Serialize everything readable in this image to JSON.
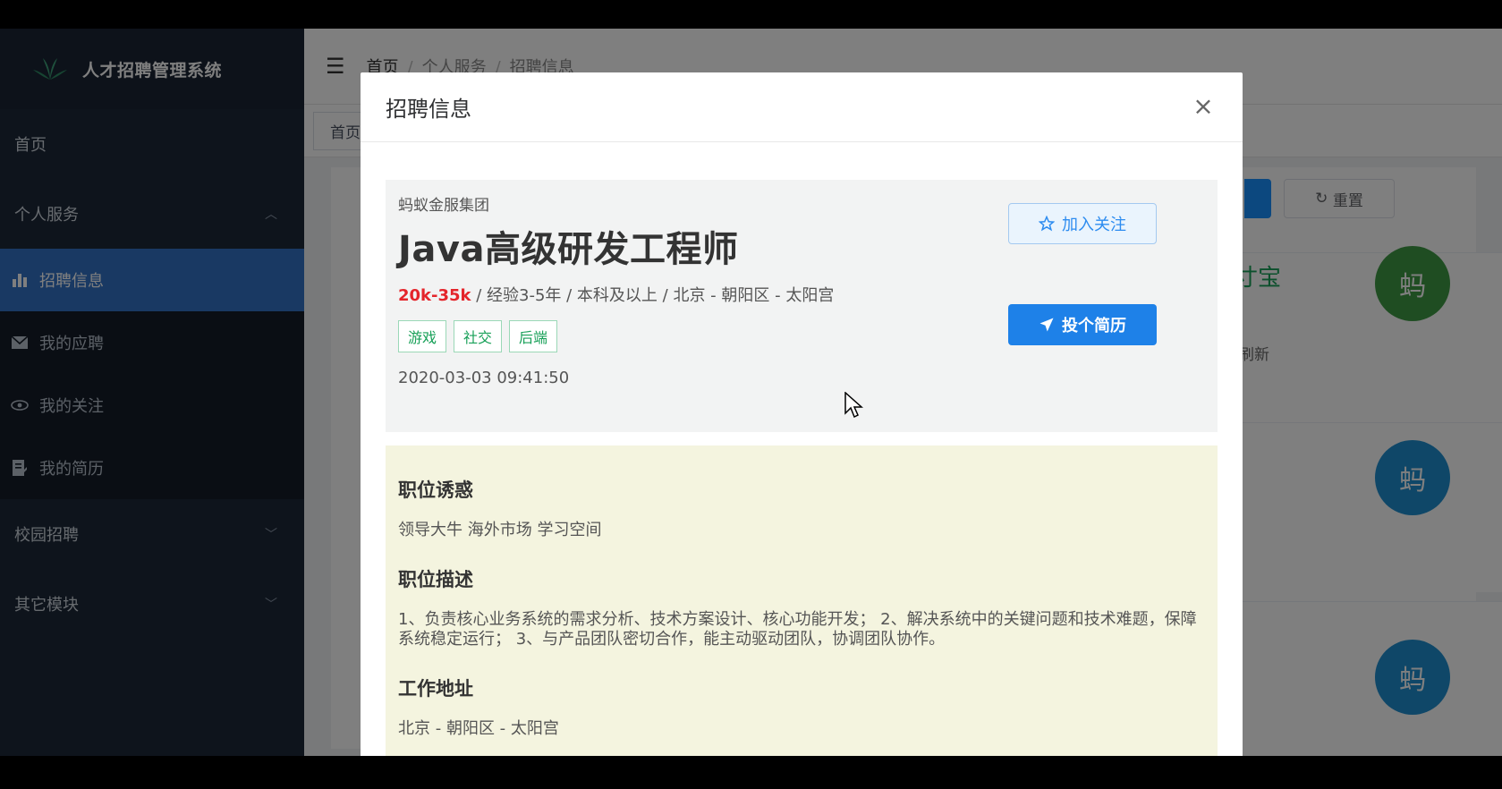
{
  "sidebar": {
    "brand": "人才招聘管理系统",
    "home": "首页",
    "personal_service": "个人服务",
    "sub_items": [
      "招聘信息",
      "我的应聘",
      "我的关注",
      "我的简历"
    ],
    "campus": "校园招聘",
    "other": "其它模块"
  },
  "topbar": {
    "breadcrumb": [
      "首页",
      "个人服务",
      "招聘信息"
    ]
  },
  "tagsbar": {
    "tag": "首页"
  },
  "background": {
    "reset_label": "重置",
    "peek_text": "寸宝",
    "peek_small": "刷新",
    "avatar_char": "蚂",
    "avatar_colors": [
      "#3f9a45",
      "#1e8fd0",
      "#1e8fd0"
    ]
  },
  "modal": {
    "title": "招聘信息",
    "close": "×",
    "company": "蚂蚁金服集团",
    "job_title": "Java高级研发工程师",
    "salary": "20k-35k",
    "meta": " / 经验3-5年 / 本科及以上 / 北京 - 朝阳区 - 太阳宫",
    "tags": [
      "游戏",
      "社交",
      "后端"
    ],
    "published": "2020-03-03 09:41:50",
    "follow_label": "加入关注",
    "apply_label": "投个简历",
    "sections": [
      {
        "title": "职位诱惑",
        "text": "领导大牛 海外市场 学习空间"
      },
      {
        "title": "职位描述",
        "text": "1、负责核心业务系统的需求分析、技术方案设计、核心功能开发； 2、解决系统中的关键问题和技术难题，保障系统稳定运行； 3、与产品团队密切合作，能主动驱动团队，协调团队协作。"
      },
      {
        "title": "工作地址",
        "text": "北京 - 朝阳区 - 太阳宫"
      }
    ]
  },
  "colors": {
    "accent": "#1e81e8",
    "salary": "#e4252b",
    "tag_green": "#18a058"
  }
}
